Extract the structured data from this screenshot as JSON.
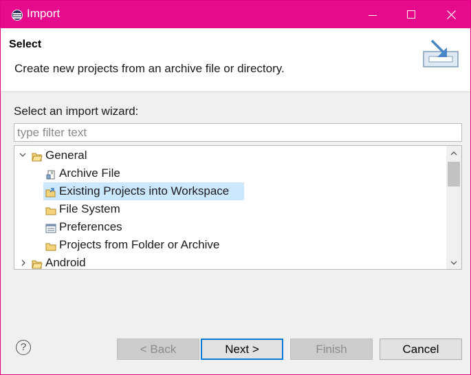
{
  "window": {
    "title": "Import"
  },
  "banner": {
    "title": "Select",
    "description": "Create new projects from an archive file or directory."
  },
  "wizard": {
    "label": "Select an import wizard:",
    "filter_placeholder": "type filter text",
    "filter_value": ""
  },
  "tree": {
    "items": [
      {
        "label": "General",
        "level": 0,
        "expanded": true,
        "icon": "folder-open-icon"
      },
      {
        "label": "Archive File",
        "level": 1,
        "icon": "archive-file-icon"
      },
      {
        "label": "Existing Projects into Workspace",
        "level": 1,
        "icon": "existing-projects-icon",
        "selected": true
      },
      {
        "label": "File System",
        "level": 1,
        "icon": "folder-icon"
      },
      {
        "label": "Preferences",
        "level": 1,
        "icon": "preferences-icon"
      },
      {
        "label": "Projects from Folder or Archive",
        "level": 1,
        "icon": "folder-icon"
      },
      {
        "label": "Android",
        "level": 0,
        "expanded": false,
        "icon": "folder-open-icon"
      }
    ]
  },
  "buttons": {
    "help": "?",
    "back": "< Back",
    "next": "Next >",
    "finish": "Finish",
    "cancel": "Cancel"
  },
  "colors": {
    "titlebar": "#e60b8c",
    "selection": "#cce8ff",
    "default_button_border": "#0078d7"
  }
}
